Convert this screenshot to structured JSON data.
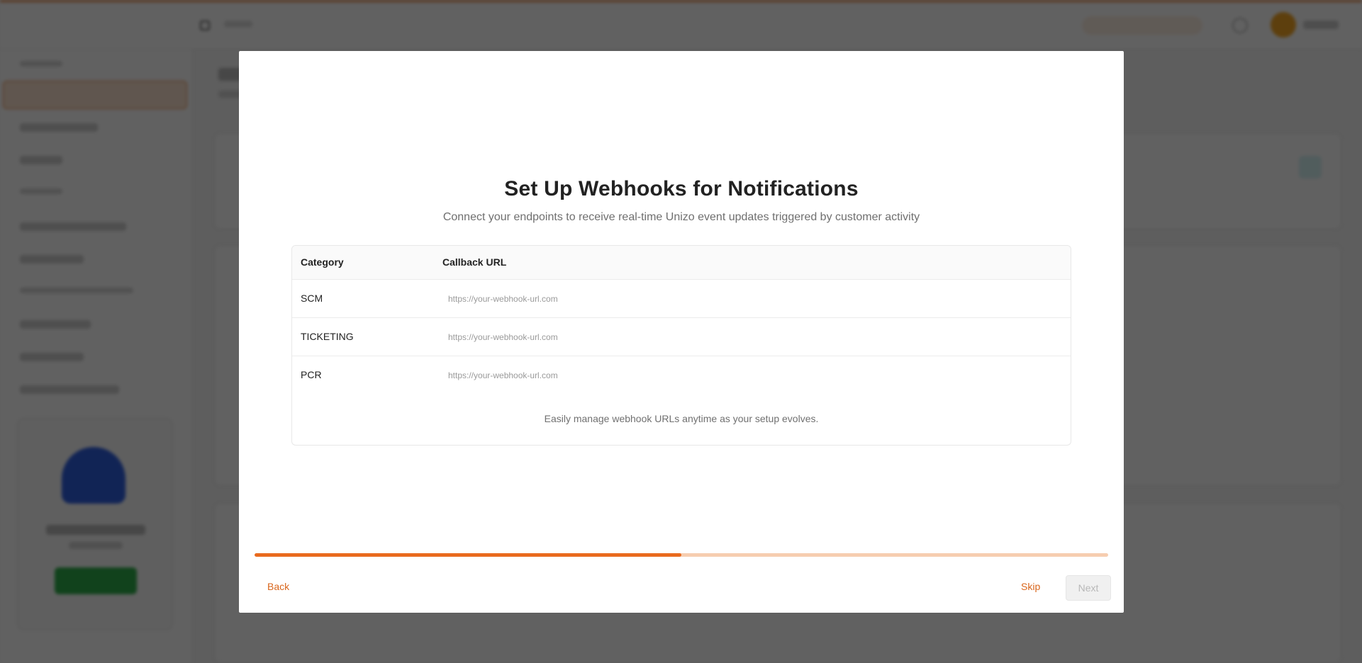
{
  "modal": {
    "title": "Set Up Webhooks for Notifications",
    "subtitle": "Connect your endpoints to receive real-time Unizo event updates triggered by customer activity",
    "table": {
      "headers": [
        "Category",
        "Callback URL"
      ],
      "rows": [
        {
          "category": "SCM",
          "url": "",
          "placeholder": "https://your-webhook-url.com"
        },
        {
          "category": "TICKETING",
          "url": "",
          "placeholder": "https://your-webhook-url.com"
        },
        {
          "category": "PCR",
          "url": "",
          "placeholder": "https://your-webhook-url.com"
        }
      ]
    },
    "note": "Easily manage webhook URLs anytime as your setup evolves.",
    "progress": 0.5,
    "buttons": {
      "back": "Back",
      "skip": "Skip",
      "next": "Next"
    }
  },
  "colors": {
    "accent": "#e96a1e",
    "accent_light": "#f6cdb0",
    "link": "#d9661c",
    "disabled_bg": "#f0f0f0",
    "overlay": "rgba(0,0,0,0.62)"
  },
  "icons": [
    "sidebar-collapse-icon",
    "notification-bell-icon"
  ]
}
